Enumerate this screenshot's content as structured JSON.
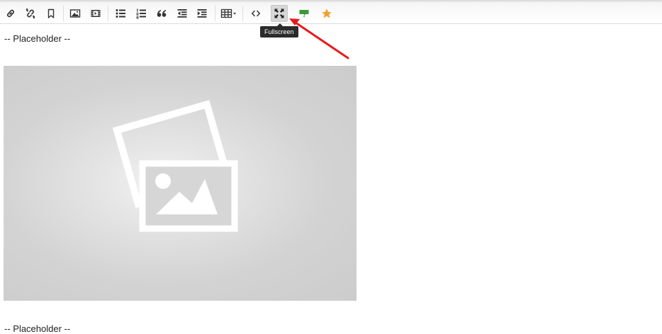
{
  "toolbar": {
    "buttons": [
      {
        "name": "link-button",
        "icon": "link-icon"
      },
      {
        "name": "unlink-button",
        "icon": "unlink-icon"
      },
      {
        "name": "bookmark-button",
        "icon": "bookmark-icon"
      },
      {
        "name": "image-button",
        "icon": "image-icon"
      },
      {
        "name": "media-button",
        "icon": "film-icon"
      },
      {
        "name": "bullet-list-button",
        "icon": "bullet-list-icon"
      },
      {
        "name": "numbered-list-button",
        "icon": "numbered-list-icon"
      },
      {
        "name": "blockquote-button",
        "icon": "quote-icon"
      },
      {
        "name": "outdent-button",
        "icon": "outdent-icon"
      },
      {
        "name": "indent-button",
        "icon": "indent-icon"
      },
      {
        "name": "table-button",
        "icon": "table-icon"
      },
      {
        "name": "source-code-button",
        "icon": "code-icon"
      },
      {
        "name": "fullscreen-button",
        "icon": "fullscreen-icon",
        "active": true
      },
      {
        "name": "highlight-button",
        "icon": "highlighter-icon",
        "color": "#3a9a3a"
      },
      {
        "name": "favorite-button",
        "icon": "star-icon",
        "color": "#f0a030"
      }
    ],
    "tooltip": "Fullscreen"
  },
  "content": {
    "paragraph_1": "-- Placeholder --",
    "paragraph_2": "-- Placeholder --",
    "image_icon": "photo-placeholder-icon"
  },
  "annotation": {
    "arrow_color": "#e8191c"
  }
}
